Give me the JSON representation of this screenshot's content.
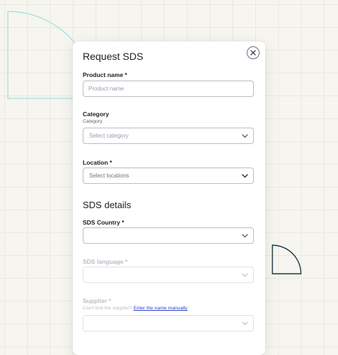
{
  "modal": {
    "title": "Request SDS",
    "product_name": {
      "label": "Product name  *",
      "placeholder": "Product name"
    },
    "category": {
      "label": "Category",
      "help": "Category",
      "placeholder": "Select category"
    },
    "location": {
      "label": "Location *",
      "placeholder": "Select locations"
    },
    "section_title": "SDS details",
    "sds_country": {
      "label": "SDS Country  *"
    },
    "sds_language": {
      "label": "SDS language  *"
    },
    "supplier": {
      "label": "Supplier  *",
      "help_prefix": "Can't find the supplier?",
      "help_link": "Enter the name manually"
    }
  },
  "icons": {
    "close": "close-icon",
    "chevron": "chevron-down-icon"
  },
  "colors": {
    "background": "#f6f5ef",
    "teal_decoration": "#9fe0df",
    "dark_decoration": "#1e3a42",
    "link": "#2f44c7"
  }
}
